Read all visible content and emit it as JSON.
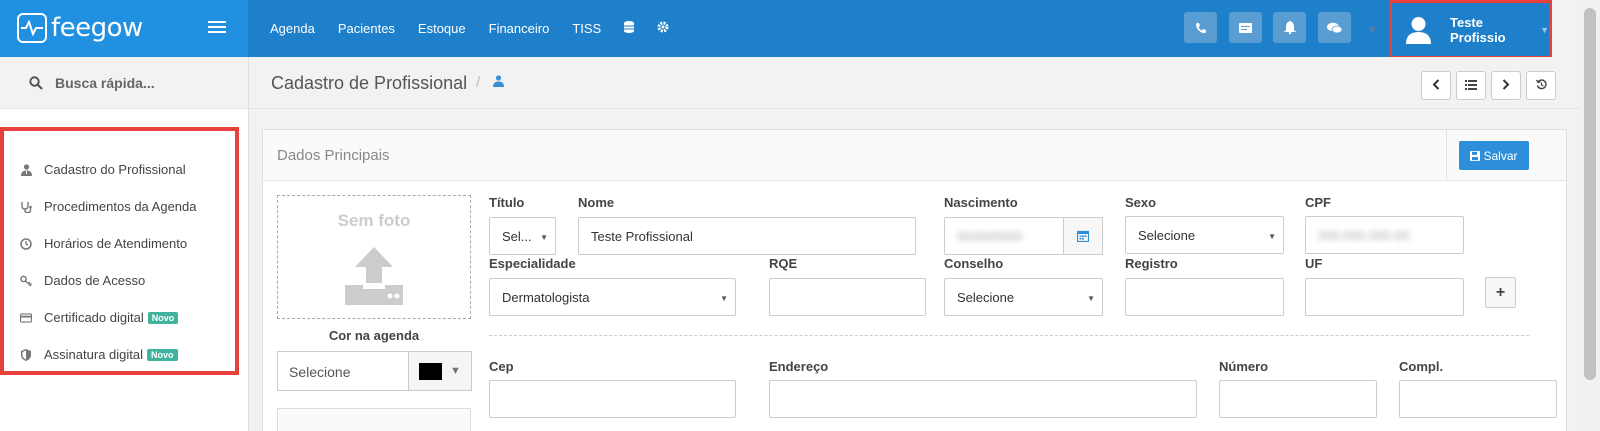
{
  "app": {
    "logo_text": "feegow"
  },
  "topnav": {
    "items": [
      "Agenda",
      "Pacientes",
      "Estoque",
      "Financeiro",
      "TISS"
    ],
    "icons": [
      "database-icon",
      "gear-icon"
    ],
    "right_buttons": [
      "phone-icon",
      "card-icon",
      "bell-icon",
      "chat-icon"
    ],
    "user_name": "Teste Profissio"
  },
  "sidebar": {
    "search_placeholder": "Busca rápida...",
    "items": [
      {
        "label": "Cadastro do Profissional",
        "icon": "user-doctor-icon",
        "badge": ""
      },
      {
        "label": "Procedimentos da Agenda",
        "icon": "stethoscope-icon",
        "badge": ""
      },
      {
        "label": "Horários de Atendimento",
        "icon": "clock-icon",
        "badge": ""
      },
      {
        "label": "Dados de Acesso",
        "icon": "key-icon",
        "badge": ""
      },
      {
        "label": "Certificado digital",
        "icon": "credit-card-icon",
        "badge": "Novo"
      },
      {
        "label": "Assinatura digital",
        "icon": "shield-icon",
        "badge": "Novo"
      }
    ]
  },
  "page": {
    "title": "Cadastro de Profissional",
    "separator": "/"
  },
  "panel": {
    "title": "Dados Principais",
    "save_label": "Salvar",
    "photo_label": "Sem foto",
    "cor_label": "Cor na agenda",
    "cor_value": "Selecione",
    "cor_swatch": "#000000"
  },
  "form": {
    "titulo_label": "Título",
    "titulo_value": "Sel...",
    "nome_label": "Nome",
    "nome_value": "Teste Profissional",
    "nascimento_label": "Nascimento",
    "nascimento_value": "00/00/0000",
    "sexo_label": "Sexo",
    "sexo_value": "Selecione",
    "cpf_label": "CPF",
    "cpf_value": "000.000.000-00",
    "especialidade_label": "Especialidade",
    "especialidade_value": "Dermatologista",
    "rqe_label": "RQE",
    "conselho_label": "Conselho",
    "conselho_value": "Selecione",
    "registro_label": "Registro",
    "uf_label": "UF",
    "cep_label": "Cep",
    "endereco_label": "Endereço",
    "numero_label": "Número",
    "compl_label": "Compl."
  },
  "colors": {
    "topbar": "#1e7fca",
    "accent": "#2d8fd9",
    "highlight": "#e8413b",
    "badge": "#3fb39d"
  }
}
